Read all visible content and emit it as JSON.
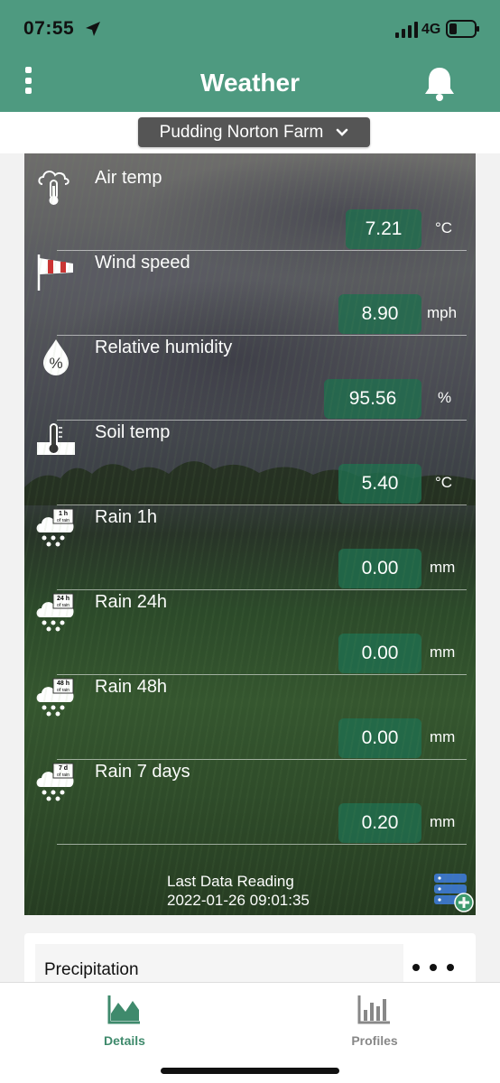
{
  "status_bar": {
    "time": "07:55",
    "network": "4G",
    "location_icon": "location-arrow-icon",
    "signal_icon": "signal-icon",
    "battery_icon": "battery-icon"
  },
  "header": {
    "title": "Weather",
    "menu_icon": "vertical-dots-icon",
    "bell_icon": "bell-icon"
  },
  "farm_selector": {
    "selected": "Pudding Norton Farm",
    "icon": "chevron-down-icon"
  },
  "readings": [
    {
      "label": "Air temp",
      "value": "7.21",
      "unit": "°C",
      "icon": "cloud-thermometer-icon"
    },
    {
      "label": "Wind speed",
      "value": "8.90",
      "unit": "mph",
      "icon": "windsock-icon"
    },
    {
      "label": "Relative humidity",
      "value": "95.56",
      "unit": "%",
      "icon": "humidity-drop-icon"
    },
    {
      "label": "Soil temp",
      "value": "5.40",
      "unit": "°C",
      "icon": "soil-thermometer-icon"
    },
    {
      "label": "Rain 1h",
      "value": "0.00",
      "unit": "mm",
      "icon": "rain-cloud-icon",
      "badge": "1 h of rain"
    },
    {
      "label": "Rain 24h",
      "value": "0.00",
      "unit": "mm",
      "icon": "rain-cloud-icon",
      "badge": "24 h of rain"
    },
    {
      "label": "Rain 48h",
      "value": "0.00",
      "unit": "mm",
      "icon": "rain-cloud-icon",
      "badge": "48 h of rain"
    },
    {
      "label": "Rain 7 days",
      "value": "0.20",
      "unit": "mm",
      "icon": "rain-cloud-icon",
      "badge": "7 d of rain"
    }
  ],
  "last_reading": {
    "label": "Last Data Reading",
    "timestamp": "2022-01-26 09:01:35",
    "icon": "database-add-icon"
  },
  "precipitation": {
    "title": "Precipitation",
    "more_icon": "more-dots-icon"
  },
  "bottom_nav": {
    "tabs": [
      {
        "label": "Details",
        "icon": "area-chart-icon",
        "active": true
      },
      {
        "label": "Profiles",
        "icon": "bar-chart-icon",
        "active": false
      }
    ]
  },
  "colors": {
    "header": "#4e9a80",
    "value_box": "#206e4e",
    "active_tab": "#3f8a6c"
  }
}
